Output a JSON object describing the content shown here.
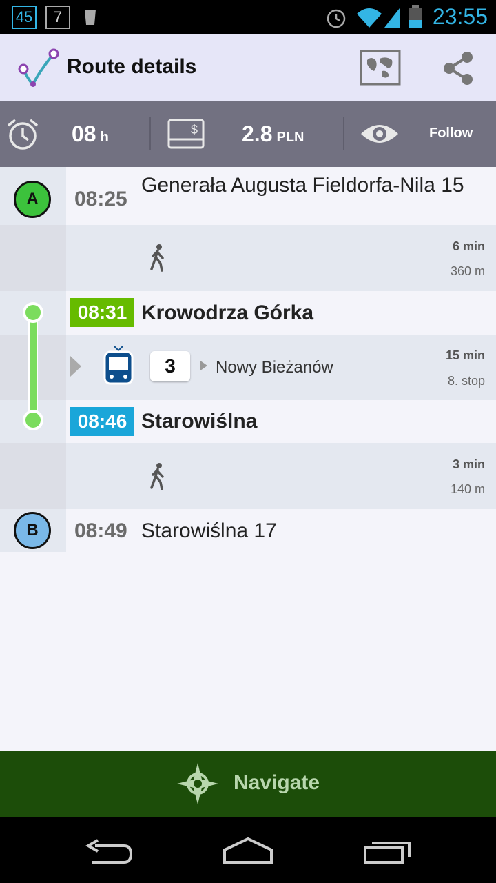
{
  "status_bar": {
    "notif_1": "45",
    "notif_2": "7",
    "time": "23:55"
  },
  "app_bar": {
    "title": "Route details",
    "icons": [
      "route-logo-icon",
      "map-icon",
      "share-icon"
    ]
  },
  "summary": {
    "duration_value": "08",
    "duration_unit": "h",
    "cost_value": "2.8",
    "cost_unit": "PLN",
    "follow_label": "Follow",
    "icons": [
      "alarm-clock-icon",
      "ticket-icon",
      "eye-icon"
    ]
  },
  "route": {
    "start": {
      "marker": "A",
      "time": "08:25",
      "place": "Generała Augusta Fieldorfa-Nila 15"
    },
    "walk_1": {
      "duration": "6 min",
      "distance": "360 m",
      "icon": "walk-icon"
    },
    "board": {
      "time": "08:31",
      "stop": "Krowodrza Górka",
      "color": "#66bb00"
    },
    "tram": {
      "line": "3",
      "direction": "Nowy Bieżanów",
      "duration": "15 min",
      "stops": "8. stop",
      "icon": "tram-icon"
    },
    "alight": {
      "time": "08:46",
      "stop": "Starowiślna",
      "color": "#1aa6d9"
    },
    "walk_2": {
      "duration": "3 min",
      "distance": "140 m",
      "icon": "walk-icon"
    },
    "end": {
      "marker": "B",
      "time": "08:49",
      "place": "Starowiślna 17"
    }
  },
  "navigate": {
    "label": "Navigate",
    "icon": "compass-icon"
  },
  "system_nav": {
    "icons": [
      "back-icon",
      "home-icon",
      "recents-icon"
    ]
  },
  "colors": {
    "accent_green": "#1c4d09",
    "route_line": "#7bdc5e",
    "marker_a": "#3cc23c",
    "marker_b": "#7ab8e8"
  }
}
